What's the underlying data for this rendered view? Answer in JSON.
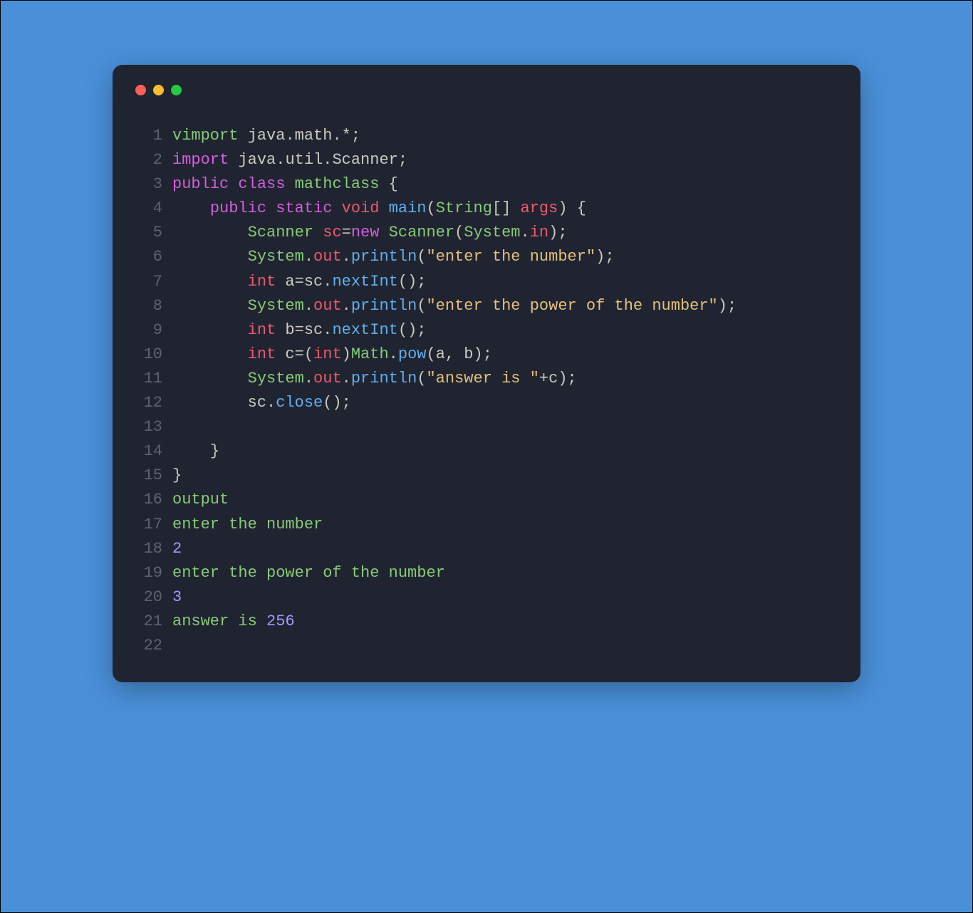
{
  "window": {
    "controls": [
      "close",
      "minimize",
      "maximize"
    ]
  },
  "colors": {
    "background": "#4a90d9",
    "editor_bg": "#1f2430",
    "line_number": "#5c6370",
    "default_text": "#cccac2",
    "keyword": "#d55fde",
    "type": "#ef596f",
    "class": "#89ca78",
    "method": "#61afef",
    "string": "#e5c07b",
    "number": "#d19a66",
    "output": "#89ca78",
    "outnum": "#a29bfe"
  },
  "code": {
    "lines": [
      {
        "n": "1",
        "tokens": [
          [
            "output",
            "vimport"
          ],
          [
            "var",
            " java"
          ],
          [
            "punct",
            "."
          ],
          [
            "var",
            "math"
          ],
          [
            "punct",
            ".*;"
          ]
        ]
      },
      {
        "n": "2",
        "tokens": [
          [
            "keyword",
            "import"
          ],
          [
            "var",
            " java"
          ],
          [
            "punct",
            "."
          ],
          [
            "var",
            "util"
          ],
          [
            "punct",
            "."
          ],
          [
            "var",
            "Scanner"
          ],
          [
            "punct",
            ";"
          ]
        ]
      },
      {
        "n": "3",
        "tokens": [
          [
            "keyword",
            "public"
          ],
          [
            "var",
            " "
          ],
          [
            "keyword",
            "class"
          ],
          [
            "var",
            " "
          ],
          [
            "class",
            "mathclass"
          ],
          [
            "var",
            " "
          ],
          [
            "punct",
            "{"
          ]
        ]
      },
      {
        "n": "4",
        "tokens": [
          [
            "var",
            "    "
          ],
          [
            "keyword",
            "public"
          ],
          [
            "var",
            " "
          ],
          [
            "keyword",
            "static"
          ],
          [
            "var",
            " "
          ],
          [
            "type",
            "void"
          ],
          [
            "var",
            " "
          ],
          [
            "method",
            "main"
          ],
          [
            "punct",
            "("
          ],
          [
            "class",
            "String"
          ],
          [
            "punct",
            "[] "
          ],
          [
            "type",
            "args"
          ],
          [
            "punct",
            ") {"
          ]
        ]
      },
      {
        "n": "5",
        "tokens": [
          [
            "var",
            "        "
          ],
          [
            "class",
            "Scanner"
          ],
          [
            "var",
            " "
          ],
          [
            "type",
            "sc"
          ],
          [
            "punct",
            "="
          ],
          [
            "keyword",
            "new"
          ],
          [
            "var",
            " "
          ],
          [
            "class",
            "Scanner"
          ],
          [
            "punct",
            "("
          ],
          [
            "class",
            "System"
          ],
          [
            "punct",
            "."
          ],
          [
            "type",
            "in"
          ],
          [
            "punct",
            ");"
          ]
        ]
      },
      {
        "n": "6",
        "tokens": [
          [
            "var",
            "        "
          ],
          [
            "class",
            "System"
          ],
          [
            "punct",
            "."
          ],
          [
            "type",
            "out"
          ],
          [
            "punct",
            "."
          ],
          [
            "method",
            "println"
          ],
          [
            "punct",
            "("
          ],
          [
            "string",
            "\"enter the number\""
          ],
          [
            "punct",
            ");"
          ]
        ]
      },
      {
        "n": "7",
        "tokens": [
          [
            "var",
            "        "
          ],
          [
            "type",
            "int"
          ],
          [
            "var",
            " a"
          ],
          [
            "punct",
            "="
          ],
          [
            "var",
            "sc"
          ],
          [
            "punct",
            "."
          ],
          [
            "method",
            "nextInt"
          ],
          [
            "punct",
            "();"
          ]
        ]
      },
      {
        "n": "8",
        "tokens": [
          [
            "var",
            "        "
          ],
          [
            "class",
            "System"
          ],
          [
            "punct",
            "."
          ],
          [
            "type",
            "out"
          ],
          [
            "punct",
            "."
          ],
          [
            "method",
            "println"
          ],
          [
            "punct",
            "("
          ],
          [
            "string",
            "\"enter the power of the number\""
          ],
          [
            "punct",
            ");"
          ]
        ]
      },
      {
        "n": "9",
        "tokens": [
          [
            "var",
            "        "
          ],
          [
            "type",
            "int"
          ],
          [
            "var",
            " b"
          ],
          [
            "punct",
            "="
          ],
          [
            "var",
            "sc"
          ],
          [
            "punct",
            "."
          ],
          [
            "method",
            "nextInt"
          ],
          [
            "punct",
            "();"
          ]
        ]
      },
      {
        "n": "10",
        "tokens": [
          [
            "var",
            "        "
          ],
          [
            "type",
            "int"
          ],
          [
            "var",
            " c"
          ],
          [
            "punct",
            "=("
          ],
          [
            "type",
            "int"
          ],
          [
            "punct",
            ")"
          ],
          [
            "class",
            "Math"
          ],
          [
            "punct",
            "."
          ],
          [
            "method",
            "pow"
          ],
          [
            "punct",
            "("
          ],
          [
            "var",
            "a"
          ],
          [
            "punct",
            ", "
          ],
          [
            "var",
            "b"
          ],
          [
            "punct",
            ");"
          ]
        ]
      },
      {
        "n": "11",
        "tokens": [
          [
            "var",
            "        "
          ],
          [
            "class",
            "System"
          ],
          [
            "punct",
            "."
          ],
          [
            "type",
            "out"
          ],
          [
            "punct",
            "."
          ],
          [
            "method",
            "println"
          ],
          [
            "punct",
            "("
          ],
          [
            "string",
            "\"answer is \""
          ],
          [
            "punct",
            "+"
          ],
          [
            "var",
            "c"
          ],
          [
            "punct",
            ");"
          ]
        ]
      },
      {
        "n": "12",
        "tokens": [
          [
            "var",
            "        sc"
          ],
          [
            "punct",
            "."
          ],
          [
            "method",
            "close"
          ],
          [
            "punct",
            "();"
          ]
        ]
      },
      {
        "n": "13",
        "tokens": [
          [
            "var",
            "        "
          ]
        ]
      },
      {
        "n": "14",
        "tokens": [
          [
            "var",
            "    "
          ],
          [
            "punct",
            "}"
          ]
        ]
      },
      {
        "n": "15",
        "tokens": [
          [
            "punct",
            "}"
          ]
        ]
      },
      {
        "n": "16",
        "tokens": [
          [
            "output",
            "output"
          ]
        ]
      },
      {
        "n": "17",
        "tokens": [
          [
            "output",
            "enter the number"
          ]
        ]
      },
      {
        "n": "18",
        "tokens": [
          [
            "outnum",
            "2"
          ]
        ]
      },
      {
        "n": "19",
        "tokens": [
          [
            "output",
            "enter the power of the number"
          ]
        ]
      },
      {
        "n": "20",
        "tokens": [
          [
            "outnum",
            "3"
          ]
        ]
      },
      {
        "n": "21",
        "tokens": [
          [
            "output",
            "answer is "
          ],
          [
            "outnum",
            "256"
          ]
        ]
      },
      {
        "n": "22",
        "tokens": []
      }
    ]
  }
}
